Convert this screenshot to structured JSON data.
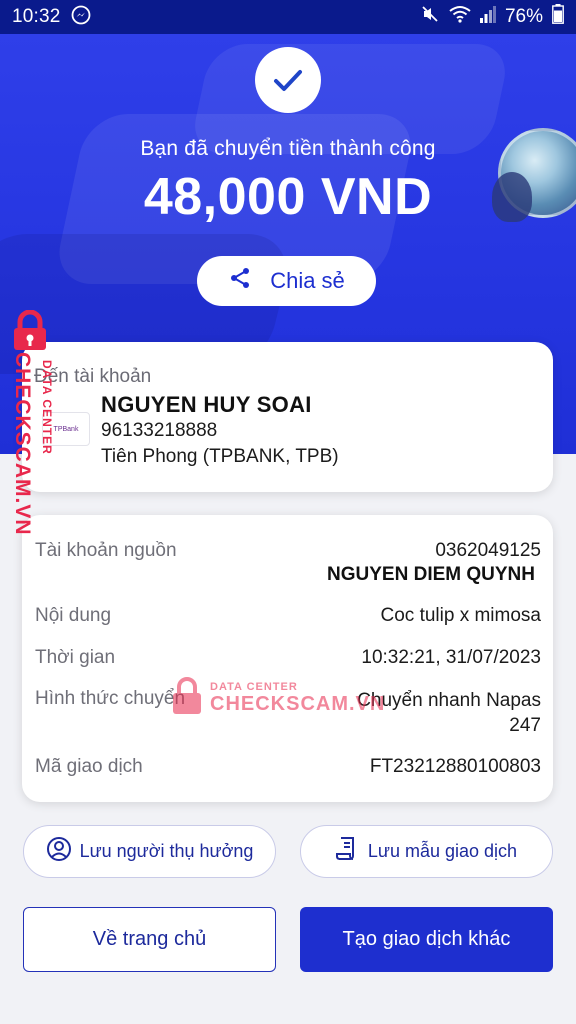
{
  "status_bar": {
    "time": "10:32",
    "battery": "76%",
    "icons": [
      "messenger-icon",
      "mute-icon",
      "wifi-icon",
      "signal-icon",
      "battery-icon"
    ]
  },
  "hero": {
    "success_text": "Bạn đã chuyển tiền thành công",
    "amount": "48,000 VND",
    "share_label": "Chia sẻ"
  },
  "recipient": {
    "label": "Đến tài khoản",
    "name": "NGUYEN HUY SOAI",
    "account": "96133218888",
    "bank": "Tiên Phong (TPBANK, TPB)",
    "bank_logo_text": "TPBank"
  },
  "details": {
    "source_label": "Tài khoản nguồn",
    "source_account": "0362049125",
    "source_name": "NGUYEN DIEM QUYNH",
    "note_label": "Nội dung",
    "note_value": "Coc tulip x mimosa",
    "time_label": "Thời gian",
    "time_value": "10:32:21, 31/07/2023",
    "method_label": "Hình thức chuyển",
    "method_value_line1": "Chuyển nhanh Napas",
    "method_value_line2": "247",
    "code_label": "Mã giao dịch",
    "code_value": "FT23212880100803"
  },
  "actions": {
    "save_recipient": "Lưu người thụ hưởng",
    "save_template": "Lưu mẫu giao dịch",
    "home": "Về trang chủ",
    "new_transaction": "Tạo giao dịch khác"
  },
  "watermark": {
    "main": "CHECKSCAM.VN",
    "sub": "DATA CENTER",
    "center_main": "CHECKSCAM.VN",
    "center_sub": "DATA CENTER"
  },
  "colors": {
    "primary": "#1e2fcf",
    "hero": "#2535e0",
    "watermark": "#e8284c"
  }
}
